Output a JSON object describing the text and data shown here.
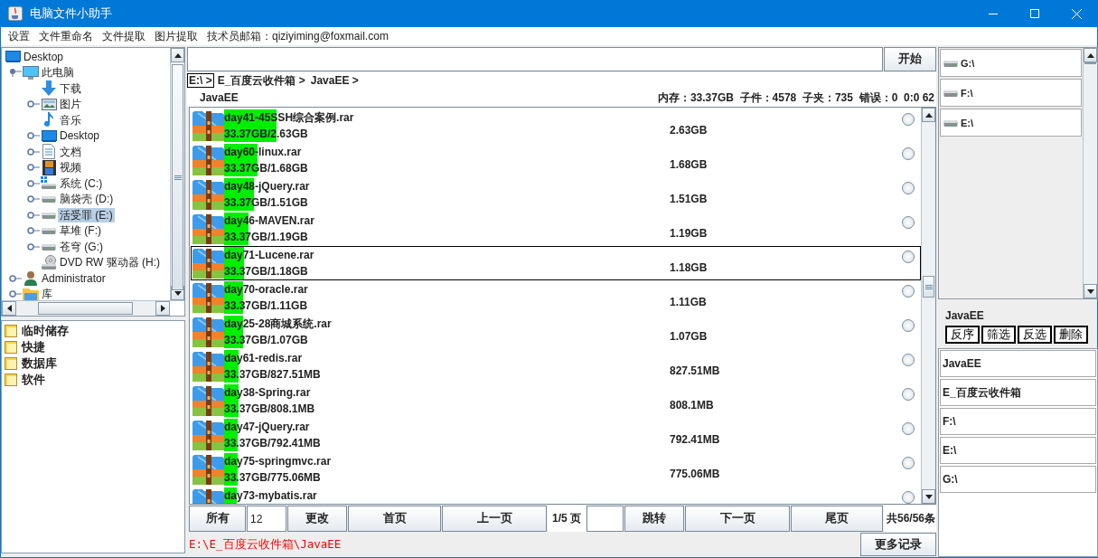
{
  "window": {
    "title": "电脑文件小助手"
  },
  "menu": [
    "设置",
    "文件重命名",
    "文件提取",
    "图片提取",
    "技术员邮箱：qiziyiming@foxmail.com"
  ],
  "tree": [
    {
      "label": "Desktop",
      "kind": "desktop",
      "selected": false,
      "children": [
        {
          "label": "此电脑",
          "kind": "computer",
          "selected": false,
          "expanded": true,
          "children": [
            {
              "label": "下载",
              "kind": "download",
              "selected": false
            },
            {
              "label": "图片",
              "kind": "picture",
              "selected": false,
              "expanded": false
            },
            {
              "label": "音乐",
              "kind": "music",
              "selected": false
            },
            {
              "label": "Desktop",
              "kind": "desktop",
              "selected": false,
              "expanded": false
            },
            {
              "label": "文档",
              "kind": "document",
              "selected": false,
              "expanded": false
            },
            {
              "label": "视频",
              "kind": "video",
              "selected": false,
              "expanded": false
            },
            {
              "label": "系统 (C:)",
              "kind": "system-drive",
              "selected": false,
              "expanded": false
            },
            {
              "label": "脑袋壳 (D:)",
              "kind": "drive",
              "selected": false,
              "expanded": false
            },
            {
              "label": "活受罪 (E:)",
              "kind": "drive",
              "selected": true,
              "expanded": false
            },
            {
              "label": "草堆 (F:)",
              "kind": "drive",
              "selected": false,
              "expanded": false
            },
            {
              "label": "苍穹 (G:)",
              "kind": "drive",
              "selected": false,
              "expanded": false
            },
            {
              "label": "DVD RW 驱动器 (H:)",
              "kind": "dvd",
              "selected": false
            }
          ]
        },
        {
          "label": "Administrator",
          "kind": "user",
          "selected": false,
          "expanded": false
        },
        {
          "label": "库",
          "kind": "folder",
          "selected": false,
          "expanded": false
        }
      ]
    }
  ],
  "favorites": [
    "临时储存",
    "快捷",
    "数据库",
    "软件"
  ],
  "start_button": "开始",
  "breadcrumb": [
    {
      "label": "E:\\ >",
      "selected": true
    },
    {
      "label": "E_百度云收件箱 >",
      "selected": false
    },
    {
      "label": "JavaEE >",
      "selected": false
    }
  ],
  "folder_label": "JavaEE",
  "stats": "内存：33.37GB  子件：4578  子夹：735  错误：0  0:0 62",
  "files": [
    {
      "name": "day41-45SSH综合案例.rar",
      "usage": "33.37GB/2.63GB",
      "size": "2.63GB",
      "level": 0.118,
      "selected": false,
      "checked": false
    },
    {
      "name": "day60-linux.rar",
      "usage": "33.37GB/1.68GB",
      "size": "1.68GB",
      "level": 0.076,
      "selected": false,
      "checked": false
    },
    {
      "name": "day48-jQuery.rar",
      "usage": "33.37GB/1.51GB",
      "size": "1.51GB",
      "level": 0.067,
      "selected": false,
      "checked": false
    },
    {
      "name": "day46-MAVEN.rar",
      "usage": "33.37GB/1.19GB",
      "size": "1.19GB",
      "level": 0.055,
      "selected": false,
      "checked": false
    },
    {
      "name": "day71-Lucene.rar",
      "usage": "33.37GB/1.18GB",
      "size": "1.18GB",
      "level": 0.045,
      "selected": true,
      "checked": false
    },
    {
      "name": "day70-oracle.rar",
      "usage": "33.37GB/1.11GB",
      "size": "1.11GB",
      "level": 0.043,
      "selected": false,
      "checked": false
    },
    {
      "name": "day25-28商城系统.rar",
      "usage": "33.37GB/1.07GB",
      "size": "1.07GB",
      "level": 0.042,
      "selected": false,
      "checked": false
    },
    {
      "name": "day61-redis.rar",
      "usage": "33.37GB/827.51MB",
      "size": "827.51MB",
      "level": 0.033,
      "selected": false,
      "checked": false
    },
    {
      "name": "day38-Spring.rar",
      "usage": "33.37GB/808.1MB",
      "size": "808.1MB",
      "level": 0.032,
      "selected": false,
      "checked": false
    },
    {
      "name": "day47-jQuery.rar",
      "usage": "33.37GB/792.41MB",
      "size": "792.41MB",
      "level": 0.031,
      "selected": false,
      "checked": false
    },
    {
      "name": "day75-springmvc.rar",
      "usage": "33.37GB/775.06MB",
      "size": "775.06MB",
      "level": 0.031,
      "selected": false,
      "checked": false
    },
    {
      "name": "day73-mybatis.rar",
      "level": 0.029,
      "selected": false,
      "checked": false
    }
  ],
  "pager": [
    {
      "kind": "button",
      "label": "所有"
    },
    {
      "kind": "field",
      "value": "12"
    },
    {
      "kind": "button",
      "label": "更改"
    },
    {
      "kind": "button",
      "label": "首页"
    },
    {
      "kind": "button",
      "label": "上一页"
    },
    {
      "kind": "text",
      "label": "1/5 页"
    },
    {
      "kind": "field"
    },
    {
      "kind": "button",
      "label": "跳转"
    },
    {
      "kind": "button",
      "label": "下一页"
    },
    {
      "kind": "button",
      "label": "尾页"
    },
    {
      "kind": "text",
      "label": "共56/56条"
    }
  ],
  "status": {
    "path": "E:\\E_百度云收件箱\\JavaEE",
    "button": "更多记录"
  },
  "drives": [
    "G:\\",
    "F:\\",
    "E:\\"
  ],
  "side": {
    "folder_label": "JavaEE",
    "buttons": [
      "反序",
      "筛选",
      "反选",
      "删除"
    ],
    "history": [
      "JavaEE",
      "E_百度云收件箱",
      "F:\\",
      "E:\\",
      "G:\\"
    ]
  }
}
